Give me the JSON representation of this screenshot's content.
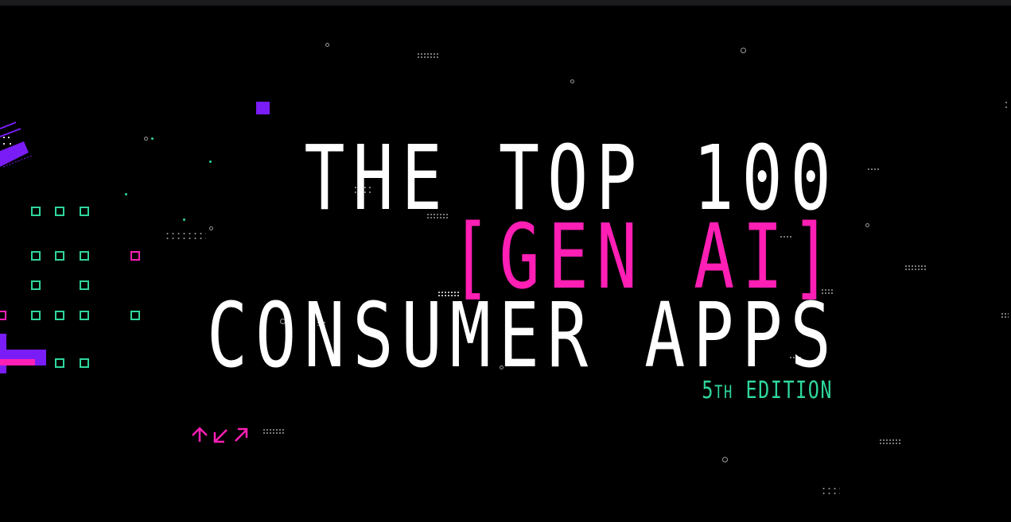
{
  "hero": {
    "line1": "THE TOP 100",
    "line2": "[GEN AI]",
    "line3": "CONSUMER APPS",
    "edition_number": "5",
    "edition_suffix": "TH",
    "edition_word": " EDITION"
  },
  "colors": {
    "background": "#000000",
    "text_white": "#ffffff",
    "accent_pink": "#ff1fb5",
    "accent_green": "#2fd69a",
    "accent_purple": "#7a1cf5"
  },
  "icons": {
    "arrows": [
      "arrow-up-icon",
      "arrow-down-left-icon",
      "arrow-up-right-icon"
    ]
  }
}
